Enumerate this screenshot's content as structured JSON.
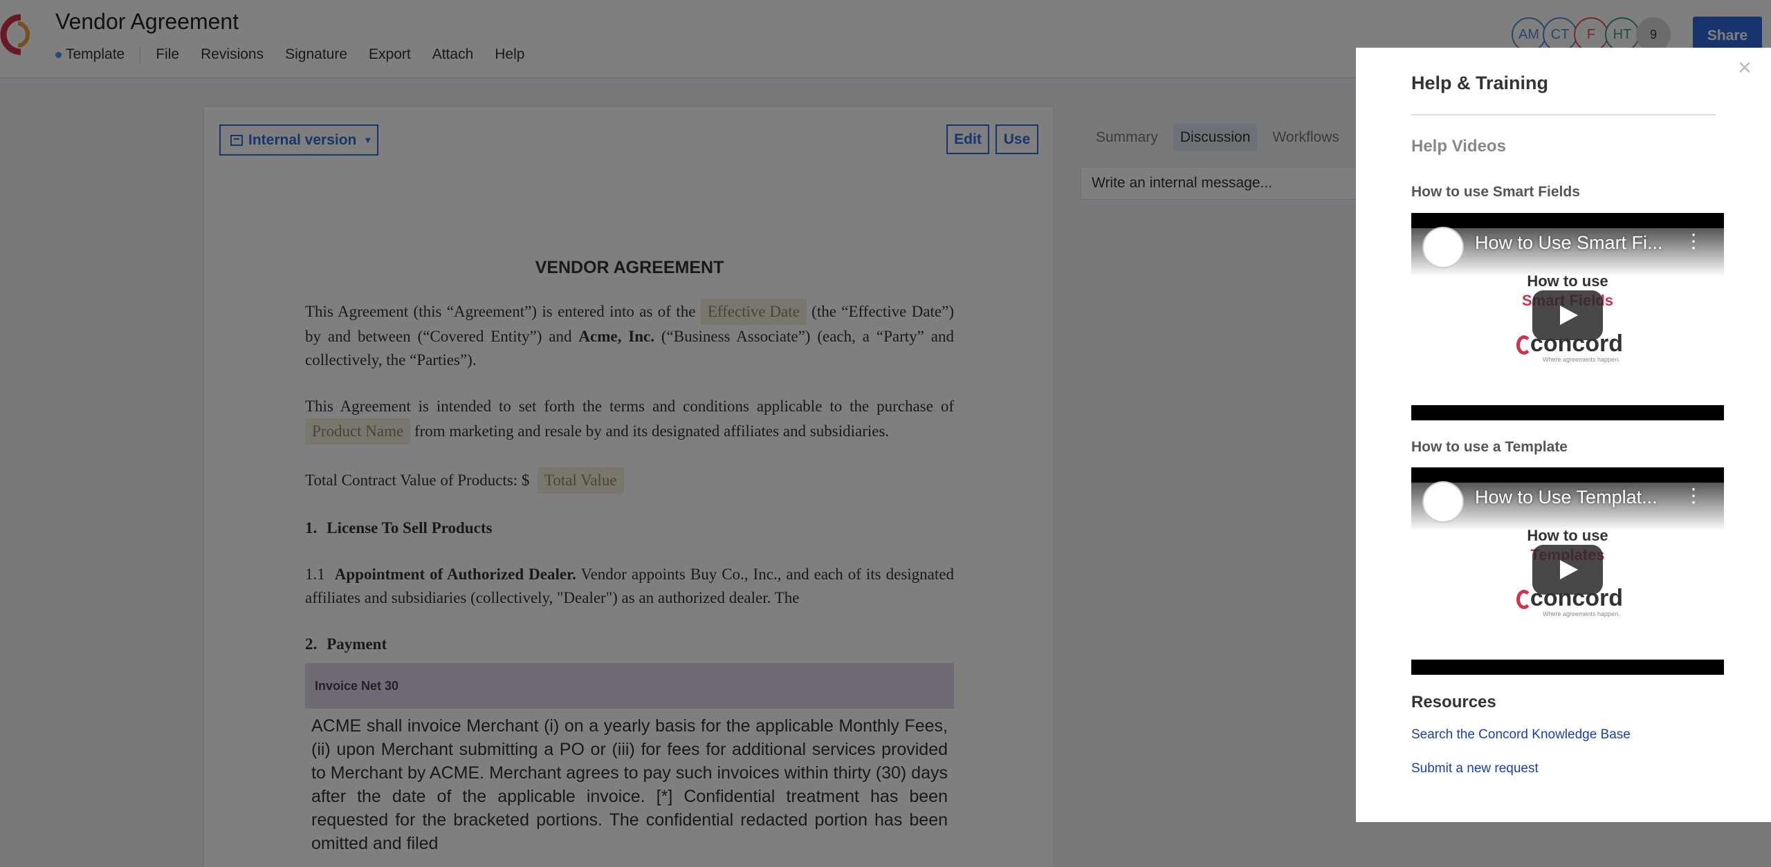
{
  "header": {
    "title": "Vendor Agreement",
    "template_label": "Template",
    "menu": [
      "File",
      "Revisions",
      "Signature",
      "Export",
      "Attach",
      "Help"
    ],
    "avatars": [
      "AM",
      "CT",
      "F",
      "HT",
      "9"
    ],
    "share_label": "Share"
  },
  "doc_toolbar": {
    "version_label": "Internal version",
    "edit_label": "Edit",
    "use_label": "Use"
  },
  "document": {
    "heading": "VENDOR AGREEMENT",
    "p1_a": "This Agreement (this “Agreement”) is entered into as of the ",
    "field_effective_date": "Effective Date",
    "p1_b": " (the “Effective Date”) by and between (“Covered Entity”) and ",
    "p1_company": "Acme, Inc.",
    "p1_c": " (“Business Associate”) (each, a “Party” and collectively, the “Parties”).",
    "p2_a": "This Agreement is intended to set forth the terms and conditions applicable to the purchase of ",
    "field_product_name": "Product Name",
    "p2_b": " from marketing and resale by and its designated affiliates and subsidiaries.",
    "p3_a": "Total Contract Value of Products: $",
    "field_total_value": "Total Value",
    "sec1_num": "1.",
    "sec1_title": "License To Sell Products",
    "s11_num": "1.1",
    "s11_title": "Appointment of Authorized Dealer.",
    "s11_text": " Vendor appoints Buy Co., Inc., and each of its designated affiliates and subsidiaries (collectively, \"Dealer\") as an authorized dealer. The",
    "sec2_num": "2.",
    "sec2_title": "Payment",
    "clause_title": "Invoice Net 30",
    "clause_text": "ACME shall invoice Merchant (i) on a yearly basis for the applicable Monthly Fees, (ii) upon Merchant submitting a PO or (iii) for fees for additional services provided to Merchant by ACME. Merchant agrees to pay such invoices within thirty (30) days after the date of the applicable invoice. [*] Confidential treatment has been requested for the bracketed portions. The confidential redacted portion has been omitted and filed"
  },
  "side_panel": {
    "tabs": [
      "Summary",
      "Discussion",
      "Workflows"
    ],
    "active_tab": "Discussion",
    "message_placeholder": "Write an internal message..."
  },
  "help": {
    "title": "Help & Training",
    "videos_heading": "Help Videos",
    "videos": [
      {
        "label": "How to use Smart Fields",
        "player_title": "How to Use Smart Fi...",
        "line1": "How to use",
        "line2": "Smart Fields",
        "brand": "concord",
        "tagline": "Where agreements happen."
      },
      {
        "label": "How to use a Template",
        "player_title": "How to Use Templat...",
        "line1": "How to use",
        "line2": "Templates",
        "brand": "concord",
        "tagline": "Where agreements happen."
      }
    ],
    "resources_heading": "Resources",
    "links": [
      "Search the Concord Knowledge Base",
      "Submit a new request"
    ],
    "close_label": "×"
  },
  "colors": {
    "accent": "#2f6bd8",
    "brand_red": "#d0324d",
    "field_bg": "#f2efdb",
    "clause_bg": "#e8e2f2"
  }
}
